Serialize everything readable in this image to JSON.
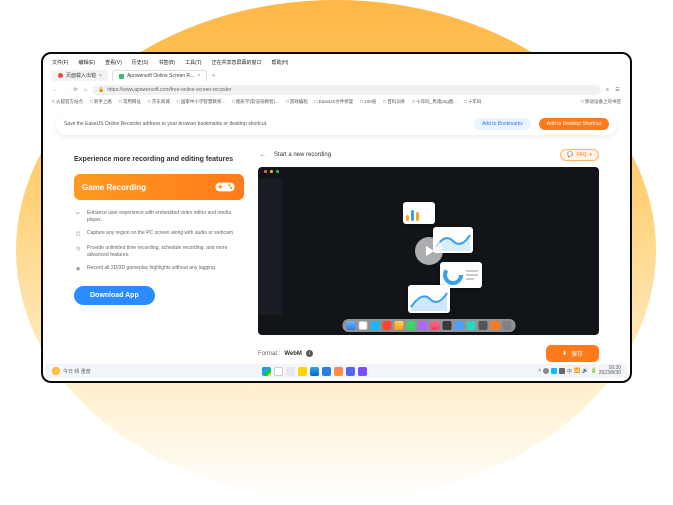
{
  "menubar": [
    "文件(F)",
    "编辑(E)",
    "查看(V)",
    "历史(S)",
    "书签(B)",
    "工具(T)",
    "正在共享您屏幕的窗口",
    "帮助(H)"
  ],
  "tabs": [
    {
      "label": "页面载入出错"
    },
    {
      "label": "Apowersoft Online Screen R..."
    }
  ],
  "url": "https://www.apowersoft.com/free-online-screen-recorder",
  "bookmarks": [
    "□ 火狐官方站点",
    "□ 新手上路",
    "□ 常用网址",
    "□ 京东商城",
    "□ 国家中小学智慧教育...",
    "□ 图形学(软渲染教程)...",
    "□ 游戏编程",
    "□ EaseUS文件修复",
    "□ 100张",
    "□ 百科词条",
    "□ 十年码_馬達png图...",
    "□ 十年码",
    "",
    "",
    "□ 移动设备上的书签"
  ],
  "banner": {
    "text": "Save the EaseUS Online Recorder address to your browser bookmarks or desktop shortcut.",
    "btn1": "Add to Bookmarks",
    "btn2": "Add to Desktop Shortcut"
  },
  "left": {
    "heading": "Experience more recording and editing features",
    "pill": "Game Recording",
    "features": [
      "Enhance user experience with embedded video editor and media player.",
      "Capture any region on the PC screen along with audio or webcam.",
      "Provide unlimited time recording, schedule recording, and more advanced features.",
      "Record all 2D/3D gameplay highlights without any lagging."
    ],
    "download": "Download App"
  },
  "right": {
    "start": "Start a new recording",
    "faq": "FAQ",
    "format_label": "Format :",
    "format_value": "WebM",
    "save": "保存"
  },
  "taskbar": {
    "weather_text": "今日 晴 重度",
    "time": "16:30",
    "date": "2023/8/30"
  },
  "colors": {
    "orange": "#ff7a1a",
    "blue": "#2a8cff"
  }
}
